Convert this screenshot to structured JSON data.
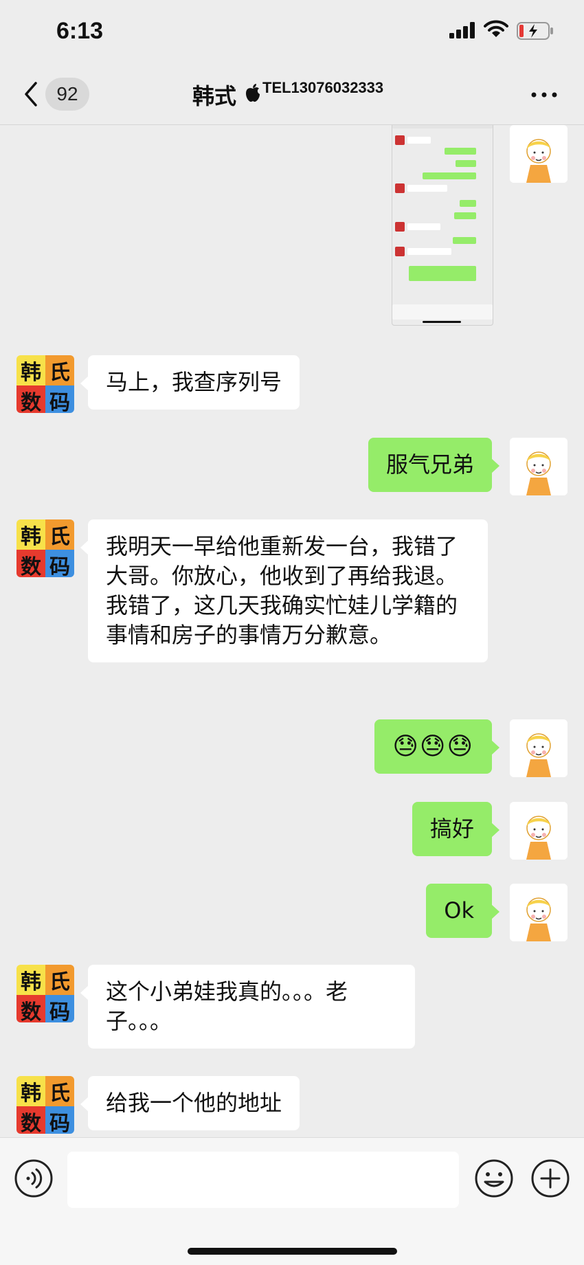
{
  "status": {
    "time": "6:13"
  },
  "header": {
    "unread_count": "92",
    "title": "韩式",
    "tel": "TEL13076032333"
  },
  "avatar_contact": {
    "chars": [
      "韩",
      "氏",
      "数",
      "码"
    ]
  },
  "messages": [
    {
      "side": "in",
      "text": "马上，我查序列号"
    },
    {
      "side": "out",
      "text": "服气兄弟"
    },
    {
      "side": "in",
      "text": "我明天一早给他重新发一台，我错了大哥。你放心，他收到了再给我退。我错了，这几天我确实忙娃儿学籍的事情和房子的事情万分歉意。"
    },
    {
      "side": "out",
      "text": "😓😓😓"
    },
    {
      "side": "out",
      "text": "搞好"
    },
    {
      "side": "out",
      "text": "Ok"
    },
    {
      "side": "in",
      "text": "这个小弟娃我真的。。。老子。。。"
    },
    {
      "side": "in",
      "text": "给我一个他的地址"
    }
  ],
  "colors": {
    "outgoing": "#95ec69",
    "incoming": "#ffffff",
    "background": "#ededed"
  }
}
